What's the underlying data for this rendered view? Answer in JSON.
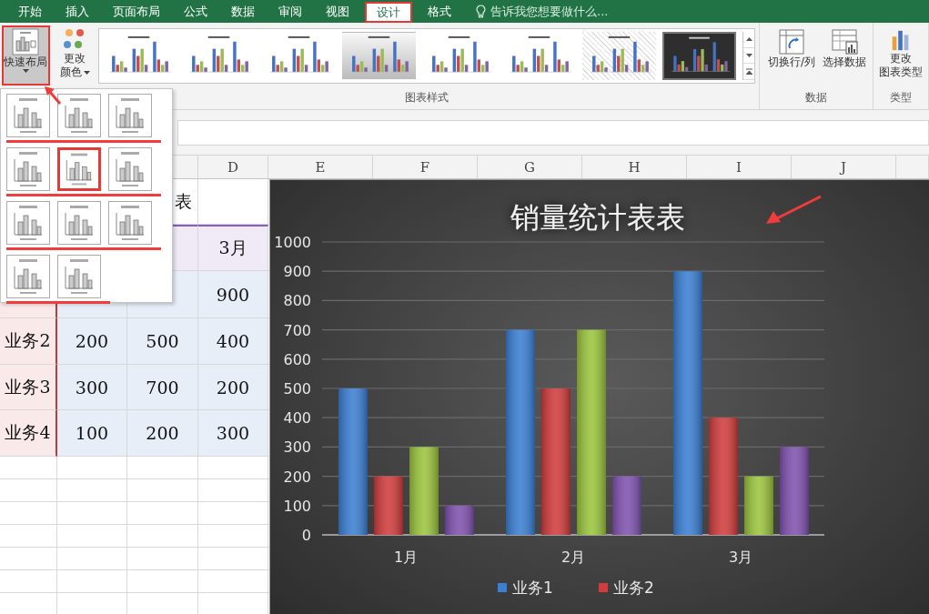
{
  "ribbon_tabs": [
    {
      "label": "开始",
      "selected": false
    },
    {
      "label": "插入",
      "selected": false
    },
    {
      "label": "页面布局",
      "selected": false
    },
    {
      "label": "公式",
      "selected": false
    },
    {
      "label": "数据",
      "selected": false
    },
    {
      "label": "审阅",
      "selected": false
    },
    {
      "label": "视图",
      "selected": false
    },
    {
      "label": "设计",
      "selected": true
    },
    {
      "label": "格式",
      "selected": false
    }
  ],
  "tell_me": {
    "placeholder": "告诉我您想要做什么..."
  },
  "ribbon": {
    "quick_layout": {
      "label": "快速布局",
      "pressed": true
    },
    "change_colors": {
      "lines": [
        "更改",
        "颜色"
      ]
    },
    "chart_styles": [
      {
        "kind": "white",
        "selected": false
      },
      {
        "kind": "white",
        "selected": false
      },
      {
        "kind": "white",
        "selected": false
      },
      {
        "kind": "gray",
        "selected": false
      },
      {
        "kind": "white",
        "selected": false
      },
      {
        "kind": "white",
        "selected": false
      },
      {
        "kind": "hatch",
        "selected": false
      },
      {
        "kind": "dark",
        "selected": true
      }
    ],
    "styles_group": "图表样式",
    "data_buttons": [
      "切换行/列",
      "选择数据"
    ],
    "data_group": "数据",
    "change_type": {
      "lines": [
        "更改",
        "图表类型"
      ]
    },
    "type_group": "类型"
  },
  "layout_gallery": [
    [
      {
        "selected": false
      },
      {
        "selected": false
      },
      {
        "selected": false
      }
    ],
    [
      {
        "selected": false
      },
      {
        "selected": true
      },
      {
        "selected": false
      }
    ],
    [
      {
        "selected": false
      },
      {
        "selected": false
      },
      {
        "selected": false
      }
    ],
    [
      {
        "selected": false
      },
      {
        "selected": false
      }
    ]
  ],
  "sheet": {
    "columns": [
      "",
      "",
      "",
      "D",
      "E",
      "F",
      "G",
      "H",
      "I",
      "J"
    ],
    "title": "表",
    "rows": [
      {
        "kind": "header",
        "cells": [
          "",
          "",
          "",
          "3月"
        ]
      },
      {
        "kind": "data",
        "cells": [
          "",
          "",
          "",
          "900"
        ]
      },
      {
        "kind": "data",
        "cells": [
          "业务2",
          "200",
          "500",
          "400"
        ]
      },
      {
        "kind": "data",
        "cells": [
          "业务3",
          "300",
          "700",
          "200"
        ]
      },
      {
        "kind": "data",
        "cells": [
          "业务4",
          "100",
          "200",
          "300"
        ]
      }
    ]
  },
  "chart": {
    "chart_data": {
      "type": "bar",
      "title": "销量统计表表",
      "categories": [
        "1月",
        "2月",
        "3月"
      ],
      "series": [
        {
          "name": "业务1",
          "color": "#3b7fd4",
          "values": [
            500,
            700,
            900
          ]
        },
        {
          "name": "业务2",
          "color": "#d23c3c",
          "values": [
            200,
            500,
            400
          ]
        },
        {
          "color": "#9cc53e",
          "values": [
            300,
            700,
            200
          ]
        },
        {
          "color": "#8052b0",
          "values": [
            100,
            200,
            300
          ]
        }
      ],
      "grid": true,
      "legend": true,
      "ylim": [
        0,
        1000
      ],
      "yticks": [
        0,
        100,
        200,
        300,
        400,
        500,
        600,
        700,
        800,
        900,
        1000
      ]
    }
  }
}
